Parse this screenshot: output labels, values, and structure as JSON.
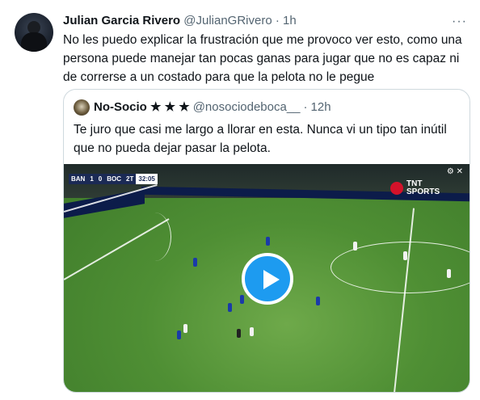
{
  "tweet": {
    "author_name": "Julian Garcia Rivero",
    "handle": "@JulianGRivero",
    "separator": "·",
    "time": "1h",
    "more_icon": "more-horizontal-icon",
    "text": "No les puedo explicar la frustración que me provoco ver esto, como una persona puede manejar tan pocas ganas para jugar que no es capaz ni de correrse a un costado para que la pelota no le pegue"
  },
  "quote": {
    "author_name": "No-Socio ★ ★ ★",
    "handle": "@nosociodeboca__",
    "separator": "·",
    "time": "12h",
    "text": "Te juro que casi me largo a llorar en esta. Nunca vi un tipo tan inútil que no pueda dejar pasar la pelota.",
    "video": {
      "score_home": "BAN",
      "score_home_goals": "1",
      "score_away_goals": "0",
      "score_away": "BOC",
      "period": "2T",
      "clock": "32:05",
      "broadcaster_line1": "TNT",
      "broadcaster_line2": "SPORTS",
      "play_icon": "play-icon"
    }
  },
  "colors": {
    "accent": "#1d9bf0",
    "muted": "#536471",
    "border": "#cfd9de"
  }
}
